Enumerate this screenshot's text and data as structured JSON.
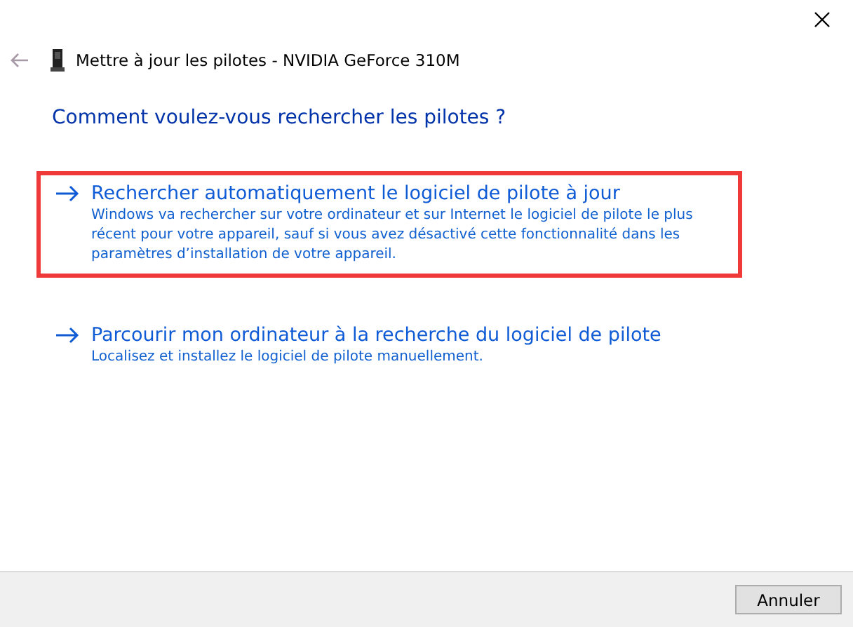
{
  "window": {
    "title": "Mettre à jour les pilotes - NVIDIA GeForce 310M"
  },
  "question": "Comment voulez-vous rechercher les pilotes ?",
  "options": [
    {
      "title": "Rechercher automatiquement le logiciel de pilote à jour",
      "description": "Windows va rechercher sur votre ordinateur et sur Internet le logiciel de pilote le plus récent pour votre appareil, sauf si vous avez désactivé cette fonctionnalité dans les paramètres d’installation de votre appareil.",
      "highlighted": true
    },
    {
      "title": "Parcourir mon ordinateur à la recherche du logiciel de pilote",
      "description": "Localisez et installez le logiciel de pilote manuellement.",
      "highlighted": false
    }
  ],
  "buttons": [
    "Annuler"
  ]
}
